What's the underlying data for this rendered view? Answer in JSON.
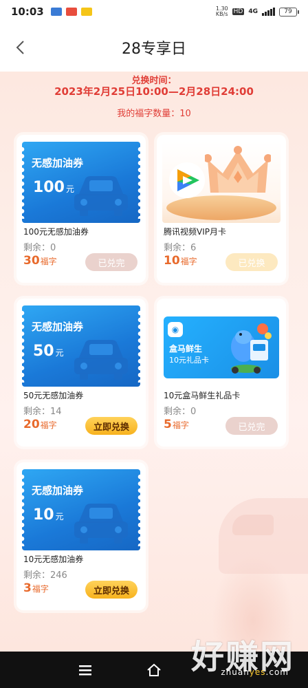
{
  "status_bar": {
    "time": "10:03",
    "speed": "1.30\nKB/s",
    "hd": "HD",
    "network": "4G",
    "battery": "79"
  },
  "header": {
    "title": "28专享日"
  },
  "exchange": {
    "label": "兑换时间：",
    "time": "2023年2月25日10:00—2月28日24:00",
    "fu_count": "我的福字数量：10"
  },
  "cards": [
    {
      "image_label": "无感加油券",
      "image_amount": "100",
      "image_unit": "元",
      "name": "100元无感加油券",
      "remain": "剩余：0",
      "price": "30",
      "price_unit": "福字",
      "button": "已兑完"
    },
    {
      "name": "腾讯视频VIP月卡",
      "remain": "剩余：6",
      "price": "10",
      "price_unit": "福字",
      "button": "已兑换"
    },
    {
      "image_label": "无感加油券",
      "image_amount": "50",
      "image_unit": "元",
      "name": "50元无感加油券",
      "remain": "剩余：14",
      "price": "20",
      "price_unit": "福字",
      "button": "立即兑换"
    },
    {
      "image_line1": "盒马鲜生",
      "image_line2": "10元礼品卡",
      "name": "10元盒马鲜生礼品卡",
      "remain": "剩余：0",
      "price": "5",
      "price_unit": "福字",
      "button": "已兑完"
    },
    {
      "image_label": "无感加油券",
      "image_amount": "10",
      "image_unit": "元",
      "name": "10元无感加油券",
      "remain": "剩余：246",
      "price": "3",
      "price_unit": "福字",
      "button": "立即兑换"
    }
  ],
  "watermark": {
    "text": "好赚网",
    "url_a": "zhuan",
    "url_b": "yes",
    "url_c": ".com"
  },
  "colors": {
    "accent_red": "#e03d36",
    "price_orange": "#e86a2c",
    "button_yellow": "#f7b21e",
    "ticket_blue": "#1a79d8"
  }
}
